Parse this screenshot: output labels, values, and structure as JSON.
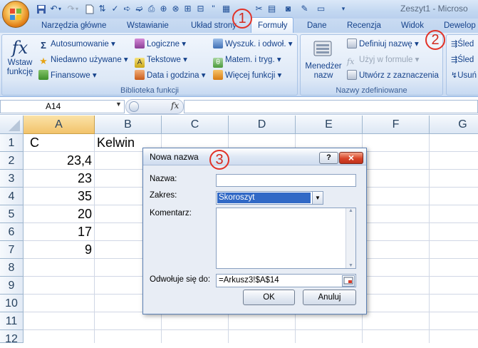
{
  "window": {
    "title": "Zeszyt1 - Microso"
  },
  "tabs": [
    {
      "label": "Narzędzia główne"
    },
    {
      "label": "Wstawianie"
    },
    {
      "label": "Układ strony"
    },
    {
      "label": "Formuły"
    },
    {
      "label": "Dane"
    },
    {
      "label": "Recenzja"
    },
    {
      "label": "Widok"
    },
    {
      "label": "Dewelop"
    }
  ],
  "ribbon": {
    "insert_function": {
      "line1": "Wstaw",
      "line2": "funkcję",
      "icon": "fx-icon"
    },
    "library": {
      "label": "Biblioteka funkcji",
      "items": [
        {
          "label": "Autosumowanie",
          "icon": "sigma-icon"
        },
        {
          "label": "Niedawno używane",
          "icon": "star-icon"
        },
        {
          "label": "Finansowe",
          "icon": "book-icon"
        },
        {
          "label": "Logiczne",
          "icon": "book-icon"
        },
        {
          "label": "Tekstowe",
          "icon": "book-icon"
        },
        {
          "label": "Data i godzina",
          "icon": "book-icon"
        },
        {
          "label": "Wyszuk. i odwoł.",
          "icon": "book-icon"
        },
        {
          "label": "Matem. i tryg.",
          "icon": "book-icon"
        },
        {
          "label": "Więcej funkcji",
          "icon": "book-icon"
        }
      ]
    },
    "names": {
      "label": "Nazwy zdefiniowane",
      "manager_line1": "Menedżer",
      "manager_line2": "nazw",
      "items": [
        {
          "label": "Definiuj nazwę"
        },
        {
          "label": "Użyj w formule"
        },
        {
          "label": "Utwórz z zaznaczenia"
        }
      ]
    },
    "audit_items": [
      {
        "label": "Śled"
      },
      {
        "label": "Śled"
      },
      {
        "label": "Usuń"
      }
    ]
  },
  "formula_bar": {
    "name_box": "A14",
    "fx": "fx"
  },
  "sheet": {
    "columns": [
      "A",
      "B",
      "C",
      "D",
      "E",
      "F",
      "G"
    ],
    "rows": [
      "1",
      "2",
      "3",
      "4",
      "5",
      "6",
      "7",
      "8",
      "9",
      "10",
      "11",
      "12"
    ],
    "cells": {
      "A1": "C",
      "B1": "Kelwin",
      "A2": "23,4",
      "A3": "23",
      "A4": "35",
      "A5": "20",
      "A6": "17",
      "A7": "9"
    }
  },
  "dialog": {
    "title": "Nowa nazwa",
    "help": "?",
    "close": "×",
    "name_label": "Nazwa:",
    "name_value": "",
    "scope_label": "Zakres:",
    "scope_value": "Skoroszyt",
    "comment_label": "Komentarz:",
    "refers_label": "Odwołuje się do:",
    "refers_value": "=Arkusz3!$A$14",
    "ok": "OK",
    "cancel": "Anuluj"
  },
  "annotations": [
    "1",
    "2",
    "3"
  ],
  "colors": {
    "accent": "#15428b",
    "selection": "#3169c6",
    "annotation": "#e23227"
  }
}
